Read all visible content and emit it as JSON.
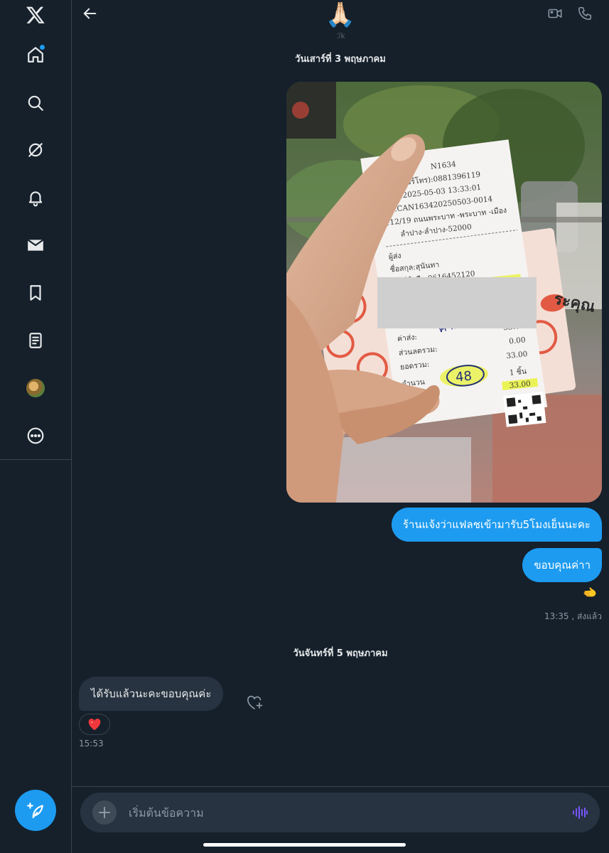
{
  "nav": {
    "items": [
      "home",
      "explore",
      "grok",
      "notifications",
      "messages",
      "bookmarks",
      "lists",
      "profile",
      "more"
    ],
    "home_has_badge": true,
    "compose_label": "compose"
  },
  "header": {
    "avatar_emoji": "🙏🏻",
    "name_fragment": "ℐk"
  },
  "conversation": {
    "date_1": "วันเสาร์ที่ 3 พฤษภาคม",
    "outgoing_1": "ร้านแจ้งว่าแฟลชเข้ามารับ5โมงเย็นนะคะ",
    "outgoing_2": "ขอบคุณค่าา",
    "outgoing_reaction": "🫲",
    "outgoing_meta": "13:35 , ส่งแล้ว",
    "date_2": "วันจันทร์ที่ 5 พฤษภาคม",
    "incoming_1": "ได้รับแล้วนะคะขอบคุณค่ะ",
    "incoming_reaction": "heart",
    "incoming_time": "15:53"
  },
  "receipt": {
    "code": "N1634",
    "tel": "TEL(เบอร์โทร):0881396119",
    "date": "Date:2025-05-03 13:33:01",
    "no": "No.CAN163420250503-0014",
    "addr1": "112/19 ถนนพระบาท -พระบาท -เมือง",
    "addr2": "ลำปาง-ลำปาง-52000",
    "sender": "ผู้ส่ง",
    "name": "ชื่อสกุล:สุนันทา",
    "phone": "เบอร์มือถือ:0616452120",
    "fee_label": "ค่าส่ง:",
    "fee_value": "33.00",
    "discount_label": "ส่วนลดรวม:",
    "discount_value": "0.00",
    "total_label": "ยอดรวม:",
    "total_value": "33.00",
    "qty_label": "จำนวน",
    "qty_value": "1 ชิ้น",
    "qty_total": "33.00",
    "handwritten_note": "ค่ากล่อง 9+6",
    "handwritten_number": "48",
    "card_text": "ระคุณ"
  },
  "composer": {
    "placeholder": "เริ่มต้นข้อความ"
  },
  "colors": {
    "background": "#15202b",
    "accent": "#1d9bf0",
    "incoming_bubble": "#273340",
    "voice": "#7856ff"
  }
}
